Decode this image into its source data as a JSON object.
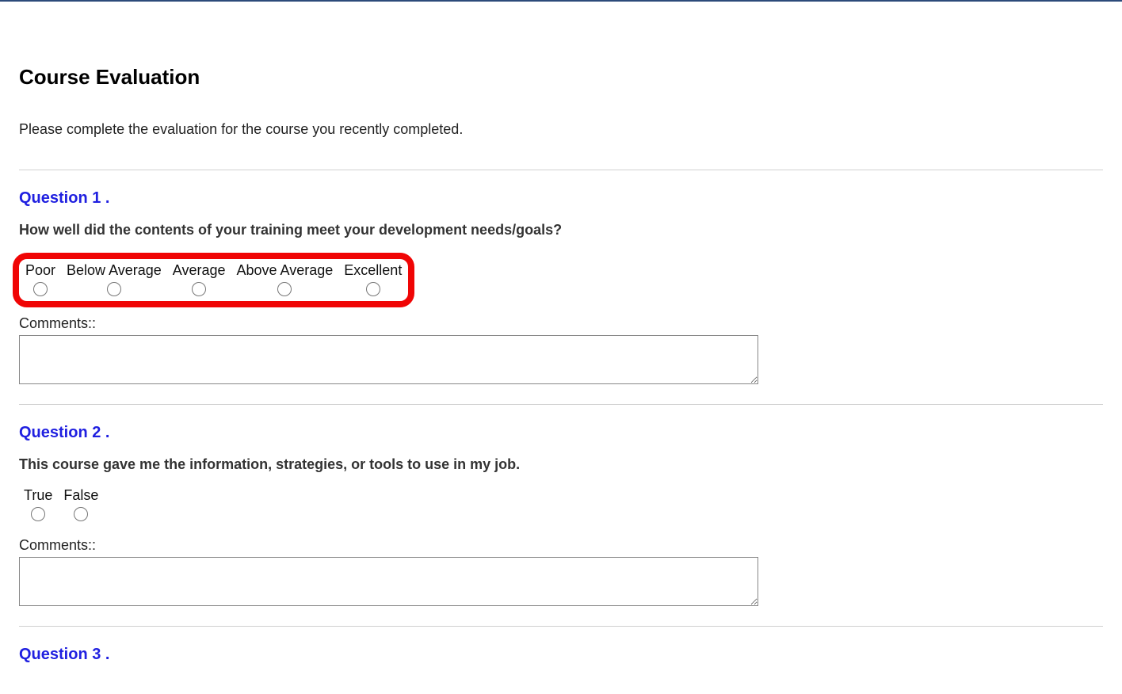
{
  "title": "Course Evaluation",
  "intro": "Please complete the evaluation for the course you recently completed.",
  "questions": {
    "q1": {
      "number": "Question 1 .",
      "text": "How well did the contents of your training meet your development needs/goals?",
      "options": [
        "Poor",
        "Below Average",
        "Average",
        "Above Average",
        "Excellent"
      ],
      "commentsLabel": "Comments::"
    },
    "q2": {
      "number": "Question 2 .",
      "text": "This course gave me the information, strategies, or tools to use in my job.",
      "options": [
        "True",
        "False"
      ],
      "commentsLabel": "Comments::"
    },
    "q3": {
      "number": "Question 3 ."
    }
  },
  "highlight": {
    "target": "q1-options",
    "color": "#f00505"
  }
}
